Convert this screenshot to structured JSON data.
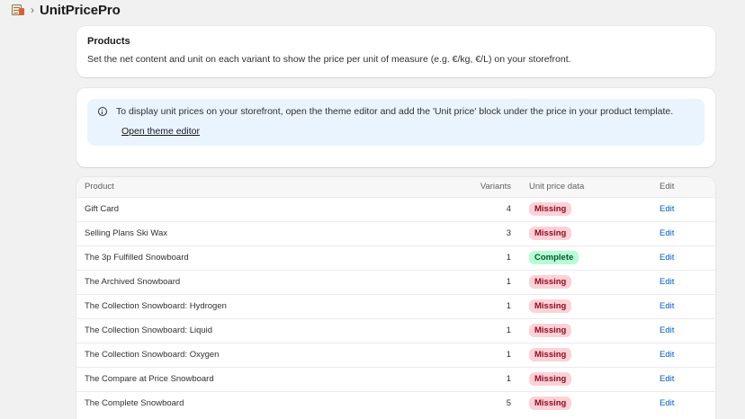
{
  "app": {
    "title": "UnitPricePro",
    "icon": "price-sheet-icon"
  },
  "products_card": {
    "title": "Products",
    "description": "Set the net content and unit on each variant to show the price per unit of measure (e.g. €/kg, €/L) on your storefront."
  },
  "notice": {
    "icon": "info-icon",
    "text": "To display unit prices on your storefront, open the theme editor and add the 'Unit price' block under the price in your product template.",
    "link_label": "Open theme editor"
  },
  "table": {
    "headers": {
      "product": "Product",
      "variants": "Variants",
      "status": "Unit price data",
      "edit": "Edit"
    },
    "rows": [
      {
        "product": "Gift Card",
        "variants": "4",
        "status": "Missing",
        "edit": "Edit"
      },
      {
        "product": "Selling Plans Ski Wax",
        "variants": "3",
        "status": "Missing",
        "edit": "Edit"
      },
      {
        "product": "The 3p Fulfilled Snowboard",
        "variants": "1",
        "status": "Complete",
        "edit": "Edit"
      },
      {
        "product": "The Archived Snowboard",
        "variants": "1",
        "status": "Missing",
        "edit": "Edit"
      },
      {
        "product": "The Collection Snowboard: Hydrogen",
        "variants": "1",
        "status": "Missing",
        "edit": "Edit"
      },
      {
        "product": "The Collection Snowboard: Liquid",
        "variants": "1",
        "status": "Missing",
        "edit": "Edit"
      },
      {
        "product": "The Collection Snowboard: Oxygen",
        "variants": "1",
        "status": "Missing",
        "edit": "Edit"
      },
      {
        "product": "The Compare at Price Snowboard",
        "variants": "1",
        "status": "Missing",
        "edit": "Edit"
      },
      {
        "product": "The Complete Snowboard",
        "variants": "5",
        "status": "Missing",
        "edit": "Edit"
      }
    ]
  },
  "colors": {
    "missing_bg": "#fed1d7",
    "complete_bg": "#b4fed2",
    "link": "#005bd3",
    "banner_bg": "#eaf4ff"
  }
}
